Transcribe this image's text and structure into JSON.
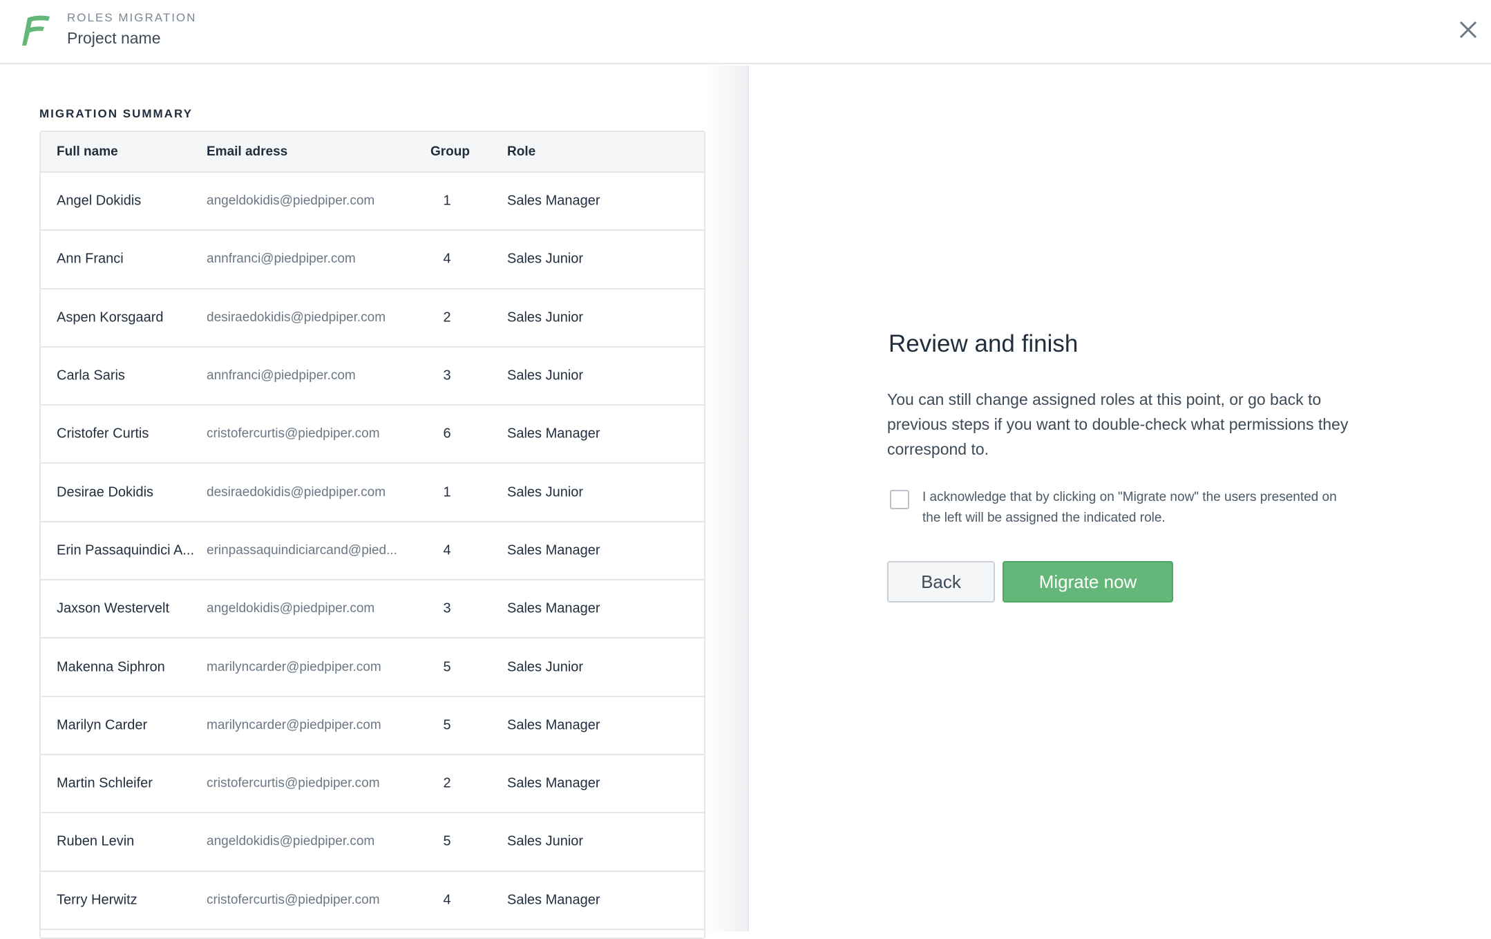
{
  "header": {
    "eyebrow": "ROLES MIGRATION",
    "project_name": "Project name",
    "close_icon": "close-icon"
  },
  "colors": {
    "brand_green": "#64b679",
    "text_dark": "#1f2d3d",
    "text_muted": "#6b7785",
    "border": "#e3e6ea"
  },
  "summary": {
    "label": "MIGRATION SUMMARY",
    "columns": [
      "Full name",
      "Email adress",
      "Group",
      "Role"
    ],
    "rows": [
      {
        "name": "Angel Dokidis",
        "email": "angeldokidis@piedpiper.com",
        "group": "1",
        "role": "Sales Manager"
      },
      {
        "name": "Ann Franci",
        "email": "annfranci@piedpiper.com",
        "group": "4",
        "role": "Sales Junior"
      },
      {
        "name": "Aspen Korsgaard",
        "email": "desiraedokidis@piedpiper.com",
        "group": "2",
        "role": "Sales Junior"
      },
      {
        "name": "Carla Saris",
        "email": "annfranci@piedpiper.com",
        "group": "3",
        "role": "Sales Junior"
      },
      {
        "name": "Cristofer Curtis",
        "email": "cristofercurtis@piedpiper.com",
        "group": "6",
        "role": "Sales Manager"
      },
      {
        "name": "Desirae Dokidis",
        "email": "desiraedokidis@piedpiper.com",
        "group": "1",
        "role": "Sales Junior"
      },
      {
        "name": "Erin Passaquindici A...",
        "email": "erinpassaquindiciarcand@pied...",
        "group": "4",
        "role": "Sales Manager"
      },
      {
        "name": "Jaxson Westervelt",
        "email": "angeldokidis@piedpiper.com",
        "group": "3",
        "role": "Sales Manager"
      },
      {
        "name": "Makenna Siphron",
        "email": "marilyncarder@piedpiper.com",
        "group": "5",
        "role": "Sales Junior"
      },
      {
        "name": "Marilyn Carder",
        "email": "marilyncarder@piedpiper.com",
        "group": "5",
        "role": "Sales Manager"
      },
      {
        "name": "Martin Schleifer",
        "email": "cristofercurtis@piedpiper.com",
        "group": "2",
        "role": "Sales Manager"
      },
      {
        "name": "Ruben Levin",
        "email": "angeldokidis@piedpiper.com",
        "group": "5",
        "role": "Sales Junior"
      },
      {
        "name": "Terry Herwitz",
        "email": "cristofercurtis@piedpiper.com",
        "group": "4",
        "role": "Sales Manager"
      }
    ]
  },
  "review": {
    "title": "Review and finish",
    "body": "You can still change assigned roles at this point, or go back to previous steps if you want to double-check what permissions they correspond to.",
    "acknowledge": "I acknowledge that by clicking on \"Migrate now\" the users presented on the left will be assigned the indicated role.",
    "acknowledge_checked": false,
    "back_label": "Back",
    "migrate_label": "Migrate now"
  }
}
